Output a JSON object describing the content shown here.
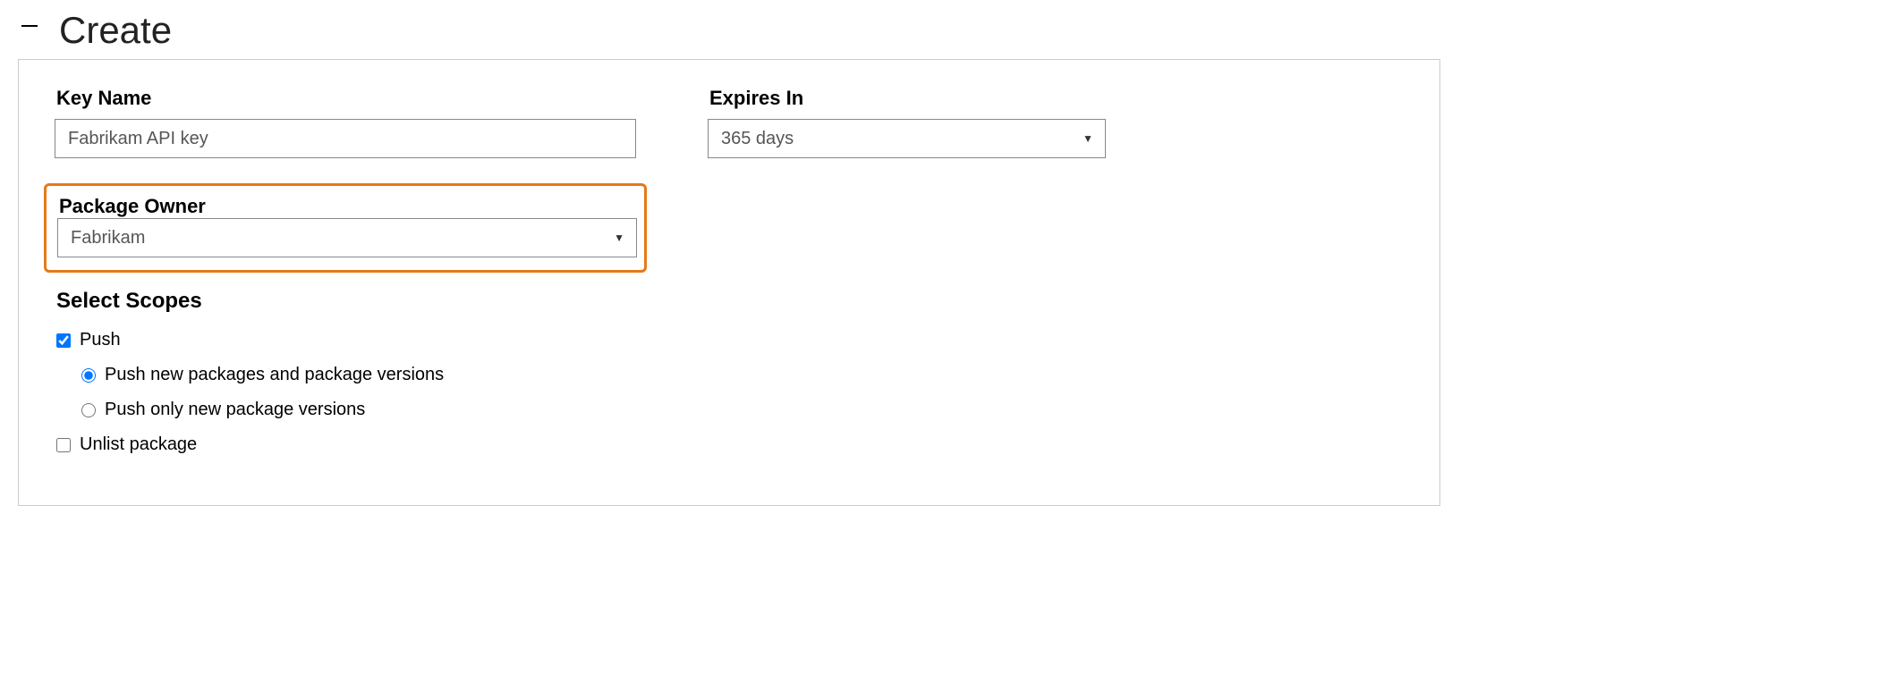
{
  "section": {
    "title": "Create"
  },
  "form": {
    "key_name": {
      "label": "Key Name",
      "value": "Fabrikam API key"
    },
    "expires": {
      "label": "Expires In",
      "value": "365 days"
    },
    "package_owner": {
      "label": "Package Owner",
      "value": "Fabrikam"
    }
  },
  "scopes": {
    "title": "Select Scopes",
    "push": {
      "label": "Push",
      "checked": true,
      "options": {
        "push_new": {
          "label": "Push new packages and package versions",
          "selected": true
        },
        "push_only_versions": {
          "label": "Push only new package versions",
          "selected": false
        }
      }
    },
    "unlist": {
      "label": "Unlist package",
      "checked": false
    }
  }
}
